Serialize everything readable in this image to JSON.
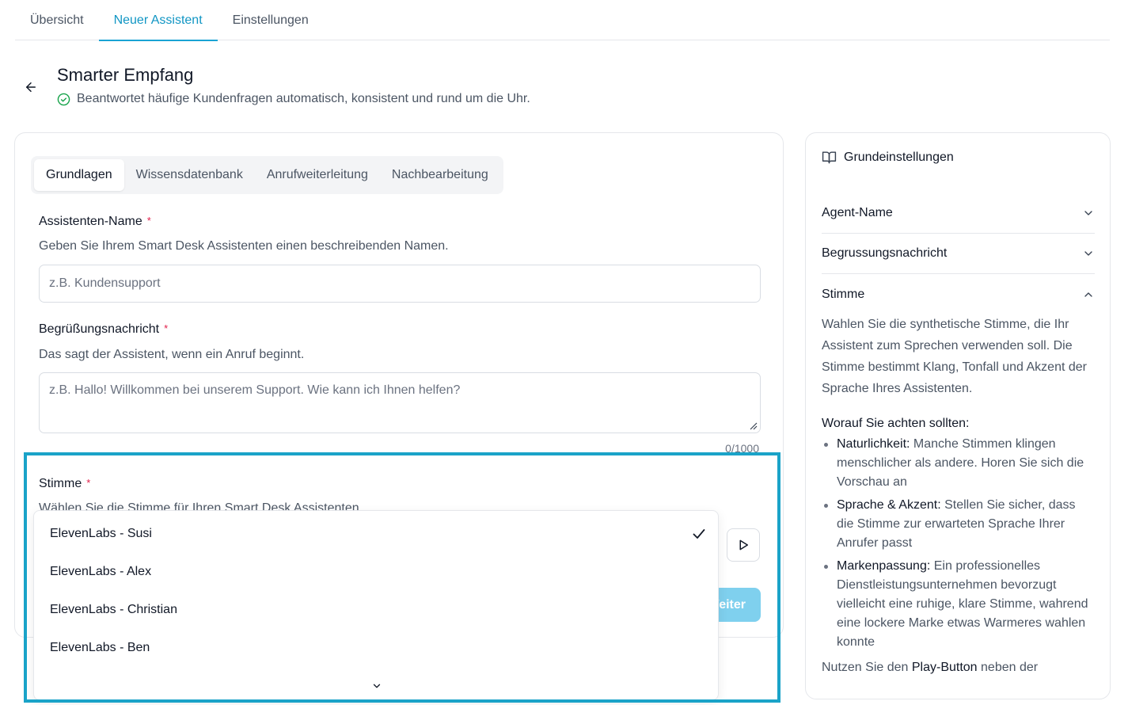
{
  "top_tabs": [
    {
      "label": "Übersicht",
      "active": false
    },
    {
      "label": "Neuer Assistent",
      "active": true
    },
    {
      "label": "Einstellungen",
      "active": false
    }
  ],
  "header": {
    "title": "Smarter Empfang",
    "subtitle": "Beantwortet häufige Kundenfragen automatisch, konsistent und rund um die Uhr."
  },
  "form_tabs": [
    {
      "label": "Grundlagen",
      "active": true
    },
    {
      "label": "Wissensdatenbank",
      "active": false
    },
    {
      "label": "Anrufweiterleitung",
      "active": false
    },
    {
      "label": "Nachbearbeitung",
      "active": false
    }
  ],
  "fields": {
    "name": {
      "label": "Assistenten-Name",
      "required": "*",
      "help": "Geben Sie Ihrem Smart Desk Assistenten einen beschreibenden Namen.",
      "placeholder": "z.B. Kundensupport"
    },
    "greeting": {
      "label": "Begrüßungsnachricht",
      "required": "*",
      "help": "Das sagt der Assistent, wenn ein Anruf beginnt.",
      "placeholder": "z.B. Hallo! Willkommen bei unserem Support. Wie kann ich Ihnen helfen?",
      "count": "0/1000"
    },
    "voice": {
      "label": "Stimme",
      "required": "*",
      "help": "Wählen Sie die Stimme für Ihren Smart Desk Assistenten."
    }
  },
  "voice_options": [
    {
      "label": "ElevenLabs - Susi",
      "selected": true
    },
    {
      "label": "ElevenLabs - Alex",
      "selected": false
    },
    {
      "label": "ElevenLabs - Christian",
      "selected": false
    },
    {
      "label": "ElevenLabs - Ben",
      "selected": false
    }
  ],
  "next_button": "Weiter",
  "sidebar": {
    "title": "Grundeinstellungen",
    "items": [
      {
        "label": "Agent-Name",
        "expanded": false
      },
      {
        "label": "Begrussungsnachricht",
        "expanded": false
      },
      {
        "label": "Stimme",
        "expanded": true
      }
    ],
    "description": "Wahlen Sie die synthetische Stimme, die Ihr Assistent zum Sprechen verwenden soll. Die Stimme bestimmt Klang, Tonfall und Akzent der Sprache Ihres Assistenten.",
    "tips_heading": "Worauf Sie achten sollten:",
    "tips": [
      {
        "term": "Naturlichkeit:",
        "text": " Manche Stimmen klingen menschlicher als andere. Horen Sie sich die Vorschau an"
      },
      {
        "term": "Sprache & Akzent:",
        "text": " Stellen Sie sicher, dass die Stimme zur erwarteten Sprache Ihrer Anrufer passt"
      },
      {
        "term": "Markenpassung:",
        "text": " Ein professionelles Dienstleistungsunternehmen bevorzugt vielleicht eine ruhige, klare Stimme, wahrend eine lockere Marke etwas Warmeres wahlen konnte"
      }
    ],
    "footer_pre": "Nutzen Sie den ",
    "footer_bold": "Play-Button",
    "footer_post": " neben der"
  },
  "colors": {
    "accent": "#1aa3d4",
    "highlight": "#1aa3c8",
    "button_disabled": "#7fd0ee",
    "required": "#e11d48",
    "success": "#16a34a"
  },
  "icons": [
    "arrow-left-icon",
    "check-circle-icon",
    "resize-grip-icon",
    "play-icon",
    "check-icon",
    "chevron-down-icon",
    "chevron-up-icon",
    "book-open-icon"
  ]
}
